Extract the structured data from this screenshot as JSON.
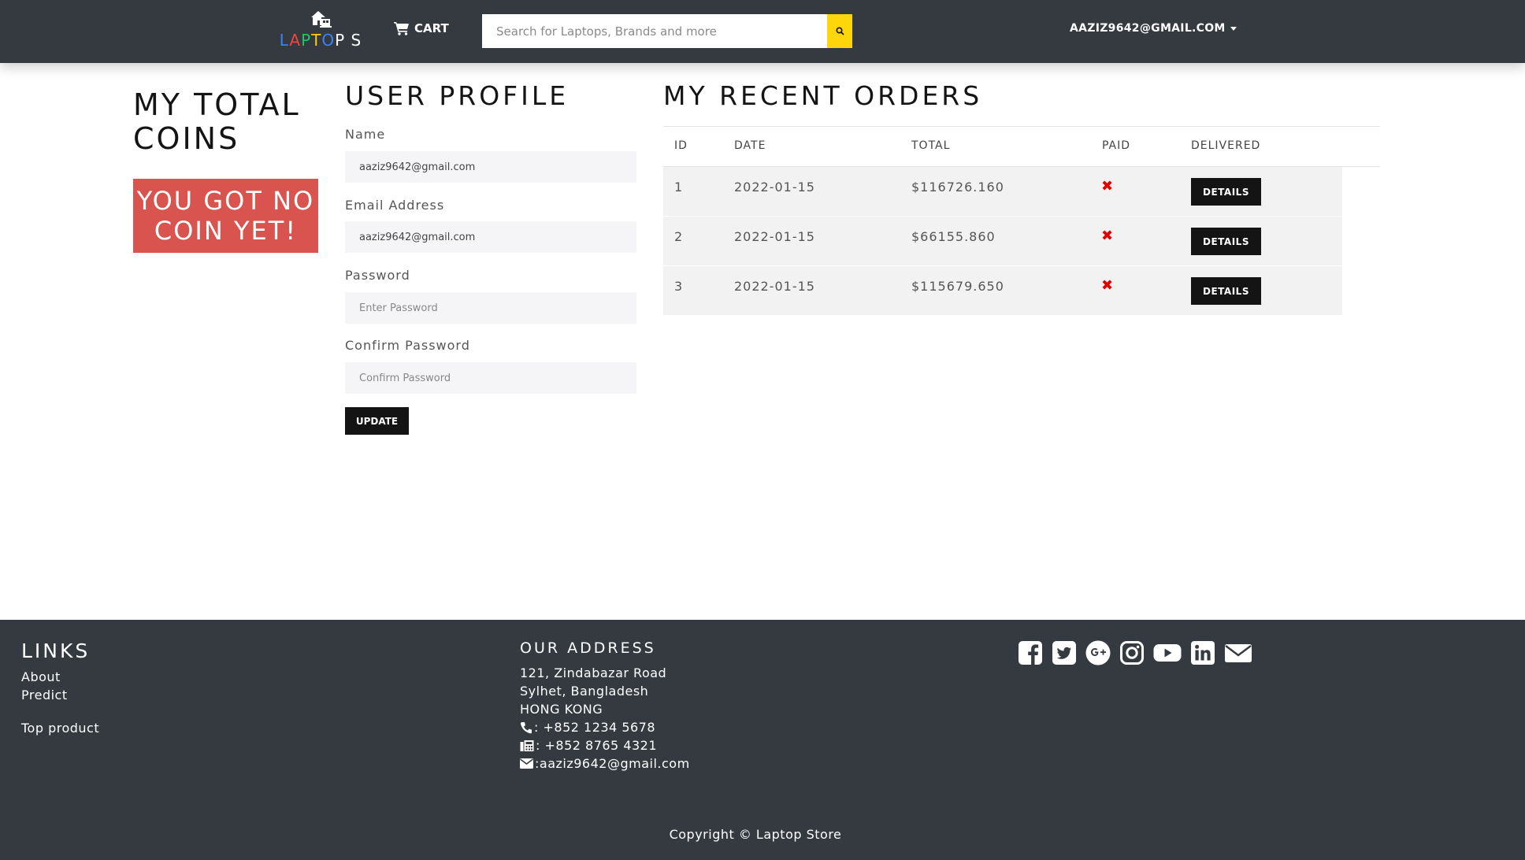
{
  "navbar": {
    "logo_letters": [
      {
        "ch": "L",
        "color": "#3b82f6"
      },
      {
        "ch": "A",
        "color": "#ef4444"
      },
      {
        "ch": "P",
        "color": "#22c55e"
      },
      {
        "ch": "T",
        "color": "#facc15"
      },
      {
        "ch": "O",
        "color": "#3b82f6"
      },
      {
        "ch": "P",
        "color": "#ffffff"
      },
      {
        "ch": " S",
        "color": "#ffffff"
      }
    ],
    "cart_label": "Cart",
    "search_placeholder": "Search for Laptops, Brands and more",
    "user_label": "AAZIZ9642@GMAIL.COM",
    "search_button_color": "#ffd60a"
  },
  "coins": {
    "title": "My Total Coins",
    "badge": "You got no coin yet!",
    "badge_color": "#d9534f"
  },
  "profile": {
    "title": "User Profile",
    "name_label": "Name",
    "name_value": "aaziz9642@gmail.com",
    "email_label": "Email Address",
    "email_value": "aaziz9642@gmail.com",
    "password_label": "Password",
    "password_placeholder": "Enter Password",
    "confirm_label": "Confirm Password",
    "confirm_placeholder": "Confirm Password",
    "update_label": "Update"
  },
  "orders": {
    "title": "My Recent Orders",
    "headers": {
      "id": "ID",
      "date": "Date",
      "total": "Total",
      "paid": "Paid",
      "delivered": "Delivered"
    },
    "rows": [
      {
        "id": "1",
        "date": "2022-01-15",
        "total": "$116726.160",
        "paid": "✖",
        "action": "Details"
      },
      {
        "id": "2",
        "date": "2022-01-15",
        "total": "$66155.860",
        "paid": "✖",
        "action": "Details"
      },
      {
        "id": "3",
        "date": "2022-01-15",
        "total": "$115679.650",
        "paid": "✖",
        "action": "Details"
      }
    ],
    "not_paid_color": "#e00000"
  },
  "footer": {
    "links_title": "Links",
    "links": [
      "About",
      "Predict",
      "Top product"
    ],
    "address_title": "Our Address",
    "address_lines": [
      "121, Zindabazar Road",
      "Sylhet, Bangladesh",
      "HONG KONG"
    ],
    "phone": ": +852 1234 5678",
    "fax": ": +852 8765 4321",
    "email": ":aaziz9642@gmail.com",
    "social_icons": [
      "facebook-icon",
      "twitter-icon",
      "google-plus-icon",
      "instagram-icon",
      "youtube-icon",
      "linkedin-icon",
      "envelope-icon"
    ],
    "copyright": "Copyright © Laptop Store"
  }
}
